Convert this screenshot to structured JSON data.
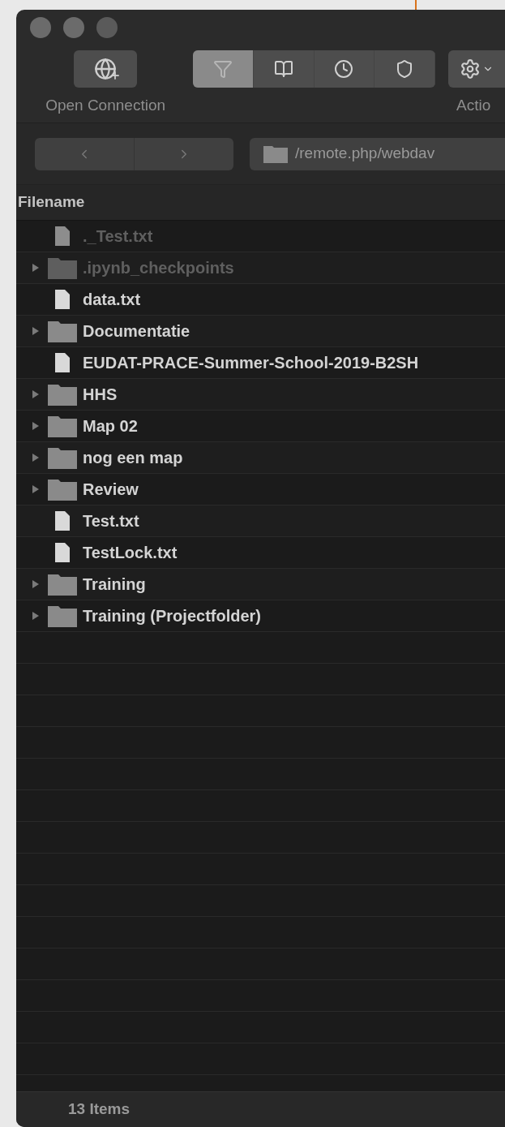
{
  "toolbar": {
    "open_connection": {
      "label": "Open Connection"
    },
    "view_tabs": [
      {
        "selected": true
      },
      {
        "selected": false
      },
      {
        "selected": false
      },
      {
        "selected": false
      }
    ],
    "action": {
      "label": "Actio"
    }
  },
  "path_bar": {
    "path": "/remote.php/webdav"
  },
  "table": {
    "columns": [
      "Filename"
    ],
    "rows": [
      {
        "name": "._Test.txt",
        "kind": "file",
        "hidden": true
      },
      {
        "name": ".ipynb_checkpoints",
        "kind": "folder",
        "hidden": true
      },
      {
        "name": "data.txt",
        "kind": "file",
        "hidden": false
      },
      {
        "name": "Documentatie",
        "kind": "folder",
        "hidden": false
      },
      {
        "name": "EUDAT-PRACE-Summer-School-2019-B2SH",
        "kind": "file",
        "hidden": false
      },
      {
        "name": "HHS",
        "kind": "folder",
        "hidden": false
      },
      {
        "name": "Map 02",
        "kind": "folder",
        "hidden": false
      },
      {
        "name": "nog een map",
        "kind": "folder",
        "hidden": false
      },
      {
        "name": "Review",
        "kind": "folder",
        "hidden": false
      },
      {
        "name": "Test.txt",
        "kind": "file",
        "hidden": false
      },
      {
        "name": "TestLock.txt",
        "kind": "file",
        "hidden": false
      },
      {
        "name": "Training",
        "kind": "folder",
        "hidden": false
      },
      {
        "name": "Training (Projectfolder)",
        "kind": "folder",
        "hidden": false
      }
    ]
  },
  "status_bar": {
    "text": "13 Items"
  }
}
